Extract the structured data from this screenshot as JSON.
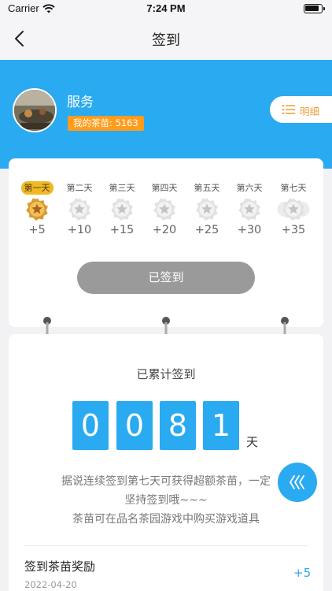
{
  "status_bar": {
    "carrier": "Carrier",
    "time": "7:24 PM"
  },
  "nav": {
    "title": "签到"
  },
  "profile": {
    "name": "服务",
    "seed_label": "我的茶苗: 5163",
    "detail_label": "明细"
  },
  "checkin": {
    "days": [
      {
        "label": "第一天",
        "points": "+5",
        "active": true
      },
      {
        "label": "第二天",
        "points": "+10",
        "active": false
      },
      {
        "label": "第三天",
        "points": "+15",
        "active": false
      },
      {
        "label": "第四天",
        "points": "+20",
        "active": false
      },
      {
        "label": "第五天",
        "points": "+25",
        "active": false
      },
      {
        "label": "第六天",
        "points": "+30",
        "active": false
      },
      {
        "label": "第七天",
        "points": "+35",
        "active": false
      }
    ],
    "button_label": "已签到"
  },
  "streak": {
    "title": "已累计签到",
    "digits": [
      "0",
      "0",
      "8",
      "1"
    ],
    "unit": "天",
    "info_lines": [
      "据说连续签到第七天可获得超额茶苗，一定",
      "坚持签到哦~~~",
      "茶苗可在品名茶园游戏中购买游戏道具"
    ]
  },
  "record": {
    "title": "签到茶苗奖励",
    "date": "2022-04-20",
    "points": "+5"
  },
  "colors": {
    "primary": "#2aaaf0",
    "accent": "#ff9c1c",
    "active_day": "#f0b823",
    "signed_button": "#9a9a9a"
  },
  "icons": {
    "back": "chevron-left-icon",
    "detail": "list-icon",
    "float": "chevrons-left-icon",
    "day_badge": "star-badge-icon"
  }
}
